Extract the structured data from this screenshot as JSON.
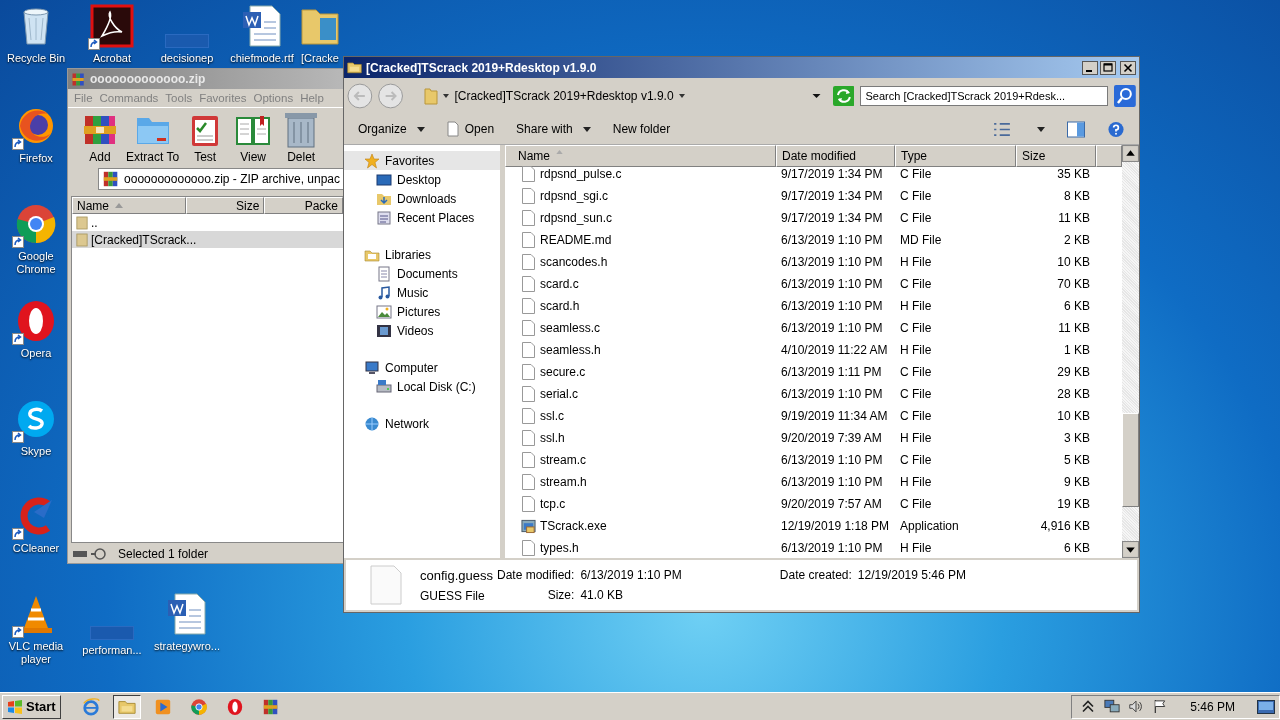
{
  "desktop_icons": [
    {
      "label": "Recycle Bin",
      "kind": "recycle",
      "shortcut": false
    },
    {
      "label": "Acrobat",
      "kind": "pdf",
      "shortcut": true
    },
    {
      "label": "decisionep",
      "kind": "blank",
      "shortcut": false
    },
    {
      "label": "chiefmode.rtf",
      "kind": "word",
      "shortcut": false
    },
    {
      "label": "[Cracke",
      "kind": "folder",
      "shortcut": false
    },
    {
      "label": "Firefox",
      "kind": "firefox",
      "shortcut": true
    },
    {
      "label": "Google Chrome",
      "kind": "chrome",
      "shortcut": true
    },
    {
      "label": "Opera",
      "kind": "opera",
      "shortcut": true
    },
    {
      "label": "Skype",
      "kind": "skype",
      "shortcut": true
    },
    {
      "label": "CCleaner",
      "kind": "ccleaner",
      "shortcut": true
    },
    {
      "label": "VLC media player",
      "kind": "vlc",
      "shortcut": true
    },
    {
      "label": "performan...",
      "kind": "blank",
      "shortcut": false
    },
    {
      "label": "strategywro...",
      "kind": "word",
      "shortcut": false
    }
  ],
  "winrar": {
    "title": "ooooooooooooo.zip",
    "menu": [
      "File",
      "Commands",
      "Tools",
      "Favorites",
      "Options",
      "Help"
    ],
    "toolbar": [
      {
        "label": "Add",
        "kind": "add"
      },
      {
        "label": "Extract To",
        "kind": "extract"
      },
      {
        "label": "Test",
        "kind": "test"
      },
      {
        "label": "View",
        "kind": "view"
      },
      {
        "label": "Delet",
        "kind": "delete"
      }
    ],
    "path": "ooooooooooooo.zip - ZIP archive, unpac",
    "columns": [
      {
        "label": "Name",
        "sorted": true
      },
      {
        "label": "Size",
        "sorted": false
      },
      {
        "label": "Packe",
        "sorted": false
      }
    ],
    "rows": [
      {
        "name": "..",
        "selected": false
      },
      {
        "name": "[Cracked]TScrack...",
        "selected": true
      }
    ],
    "status": "Selected 1 folder"
  },
  "explorer": {
    "title": "[Cracked]TScrack 2019+Rdesktop v1.9.0",
    "address": "[Cracked]TScrack 2019+Rdesktop v1.9.0",
    "search_placeholder": "Search [Cracked]TScrack 2019+Rdesk...",
    "commands": [
      {
        "label": "Organize",
        "kind": "menu"
      },
      {
        "label": "Open",
        "kind": "open"
      },
      {
        "label": "Share with",
        "kind": "menu"
      },
      {
        "label": "New folder",
        "kind": "plain"
      }
    ],
    "nav": [
      {
        "label": "Favorites",
        "kind": "star",
        "selected": true,
        "children": [
          {
            "label": "Desktop",
            "kind": "desktop"
          },
          {
            "label": "Downloads",
            "kind": "downloads"
          },
          {
            "label": "Recent Places",
            "kind": "recent"
          }
        ]
      },
      {
        "label": "Libraries",
        "kind": "library",
        "selected": false,
        "children": [
          {
            "label": "Documents",
            "kind": "documents"
          },
          {
            "label": "Music",
            "kind": "music"
          },
          {
            "label": "Pictures",
            "kind": "pictures"
          },
          {
            "label": "Videos",
            "kind": "videos"
          }
        ]
      },
      {
        "label": "Computer",
        "kind": "computer",
        "selected": false,
        "children": [
          {
            "label": "Local Disk (C:)",
            "kind": "disk"
          }
        ]
      },
      {
        "label": "Network",
        "kind": "network",
        "selected": false
      }
    ],
    "columns": [
      {
        "label": "Name",
        "sorted": true
      },
      {
        "label": "Date modified",
        "sorted": false
      },
      {
        "label": "Type",
        "sorted": false
      },
      {
        "label": "Size",
        "sorted": false
      }
    ],
    "files": [
      {
        "name": "rdpsnd_pulse.c",
        "date": "9/17/2019 1:34 PM",
        "type": "C File",
        "size": "35 KB",
        "kind": "file"
      },
      {
        "name": "rdpsnd_sgi.c",
        "date": "9/17/2019 1:34 PM",
        "type": "C File",
        "size": "8 KB",
        "kind": "file"
      },
      {
        "name": "rdpsnd_sun.c",
        "date": "9/17/2019 1:34 PM",
        "type": "C File",
        "size": "11 KB",
        "kind": "file"
      },
      {
        "name": "README.md",
        "date": "6/13/2019 1:10 PM",
        "type": "MD File",
        "size": "2 KB",
        "kind": "file"
      },
      {
        "name": "scancodes.h",
        "date": "6/13/2019 1:10 PM",
        "type": "H File",
        "size": "10 KB",
        "kind": "file"
      },
      {
        "name": "scard.c",
        "date": "6/13/2019 1:10 PM",
        "type": "C File",
        "size": "70 KB",
        "kind": "file"
      },
      {
        "name": "scard.h",
        "date": "6/13/2019 1:10 PM",
        "type": "H File",
        "size": "6 KB",
        "kind": "file"
      },
      {
        "name": "seamless.c",
        "date": "6/13/2019 1:10 PM",
        "type": "C File",
        "size": "11 KB",
        "kind": "file"
      },
      {
        "name": "seamless.h",
        "date": "4/10/2019 11:22 AM",
        "type": "H File",
        "size": "1 KB",
        "kind": "file"
      },
      {
        "name": "secure.c",
        "date": "6/13/2019 1:11 PM",
        "type": "C File",
        "size": "29 KB",
        "kind": "file"
      },
      {
        "name": "serial.c",
        "date": "6/13/2019 1:10 PM",
        "type": "C File",
        "size": "28 KB",
        "kind": "file"
      },
      {
        "name": "ssl.c",
        "date": "9/19/2019 11:34 AM",
        "type": "C File",
        "size": "10 KB",
        "kind": "file"
      },
      {
        "name": "ssl.h",
        "date": "9/20/2019 7:39 AM",
        "type": "H File",
        "size": "3 KB",
        "kind": "file"
      },
      {
        "name": "stream.c",
        "date": "6/13/2019 1:10 PM",
        "type": "C File",
        "size": "5 KB",
        "kind": "file"
      },
      {
        "name": "stream.h",
        "date": "6/13/2019 1:10 PM",
        "type": "H File",
        "size": "9 KB",
        "kind": "file"
      },
      {
        "name": "tcp.c",
        "date": "9/20/2019 7:57 AM",
        "type": "C File",
        "size": "19 KB",
        "kind": "file"
      },
      {
        "name": "TScrack.exe",
        "date": "12/19/2019 1:18 PM",
        "type": "Application",
        "size": "4,916 KB",
        "kind": "app"
      },
      {
        "name": "types.h",
        "date": "6/13/2019 1:10 PM",
        "type": "H File",
        "size": "6 KB",
        "kind": "file"
      }
    ],
    "details": {
      "name": "config.guess",
      "type": "GUESS File",
      "modified_label": "Date modified:",
      "modified": "6/13/2019 1:10 PM",
      "size_label": "Size:",
      "size": "41.0 KB",
      "created_label": "Date created:",
      "created": "12/19/2019 5:46 PM"
    }
  },
  "taskbar": {
    "start": "Start",
    "apps": [
      {
        "kind": "ie",
        "active": false
      },
      {
        "kind": "explorer",
        "active": true
      },
      {
        "kind": "media",
        "active": false
      },
      {
        "kind": "chrome",
        "active": false
      },
      {
        "kind": "opera",
        "active": false
      },
      {
        "kind": "winrar",
        "active": false
      }
    ],
    "clock": "5:46 PM"
  }
}
